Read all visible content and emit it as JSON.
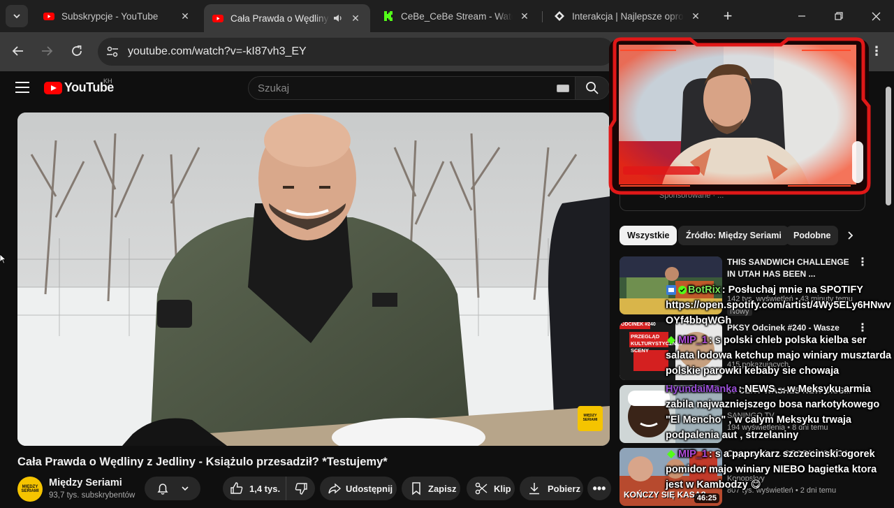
{
  "browser": {
    "tabs": [
      {
        "title": "Subskrypcje - YouTube",
        "favicon": "youtube-icon",
        "active": false
      },
      {
        "title": "Cała Prawda o Wędliny z",
        "favicon": "youtube-icon",
        "active": true,
        "audio": true
      },
      {
        "title": "CeBe_CeBe Stream - Watch L",
        "favicon": "kick-icon",
        "active": false
      },
      {
        "title": "Interakcja | Najlepsze oprog",
        "favicon": "interakcja-icon",
        "active": false
      }
    ],
    "new_tab_symbol": "+",
    "url": "youtube.com/watch?v=-kI87vh3_EY"
  },
  "youtube": {
    "logo_text": "YouTube",
    "country_code": "KH",
    "search_placeholder": "Szukaj"
  },
  "video": {
    "title": "Cała Prawda o Wędliny z Jedliny - Książulo przesadził? *Testujemy*",
    "channel": {
      "name": "Między Seriami",
      "subscribers": "93,7 tys. subskrybentów",
      "avatar_text": "MIĘDZY SERIAMI"
    },
    "actions": {
      "likes": "1,4 tys.",
      "share": "Udostępnij",
      "save": "Zapisz",
      "clip": "Klip",
      "download": "Pobierz"
    },
    "watermark_text": "MIĘDZY SERIAMI"
  },
  "sidebar": {
    "partial_text": "Sponsorowane · ...",
    "chips": [
      "Wszystkie",
      "Źródło: Między Seriami",
      "Podobne"
    ],
    "recommendations": [
      {
        "title": "THIS SANDWICH CHALLENGE IN UTAH HAS BEEN ...",
        "meta1": "142 tys. wyświetleń • 43 minuty temu",
        "badge": "Nowy"
      },
      {
        "title": "PKSY Odcinek #240 - Wasze",
        "meta1": "415 pokazujących",
        "thumb_text": "PRZEGLĄD KULTURYSTYCZNEJ SCENY",
        "thumb_badge": "ODCINEK #240"
      },
      {
        "title": "50 CENT WASHES NEW DISS...",
        "meta1": "SANINGO TV",
        "meta2": "194 wyświetlenia • 8 dni temu"
      },
      {
        "title": "Czy rozmiar... GROBU KSIĘGA",
        "meta1": "Konopskyy",
        "meta2": "807 tys. wyświetleń • 2 dni temu",
        "duration": "46:25",
        "thumb_text": "KOŃCZY SIĘ KASA?"
      }
    ]
  },
  "chat": [
    {
      "user": "BotRix",
      "user_color": "#7ce65a",
      "text": ": Posłuchaj mnie na SPOTIFY https://open.spotify.com/artist/4Wy5ELy6HNwvOYf4bbqWGh"
    },
    {
      "user": "MIP_1",
      "user_color": "#b04bd8",
      "text": ": s polski chleb polska kielba ser salata lodowa ketchup majo winiary musztarda polskie parowki kebaby sie chowaja"
    },
    {
      "user": "HyundaiManka",
      "user_color": "#9b4fd9",
      "text": ": NEWS -- w Meksyku armia zabila najwazniejszego bosa narkotykowego \"El Mencho\" , w calym Meksyku trwaja podpalenia aut , strzelaniny"
    },
    {
      "user": "MIP_1",
      "user_color": "#b04bd8",
      "text": ": s a paprykarz szczecinski ogorek pomidor majo winiary NIEBO bagietka ktora jest w Kambodzy 😋"
    }
  ],
  "colors": {
    "yt_red": "#ff0000",
    "bg": "#0f0f0f",
    "chrome_bg": "#1f1f1f",
    "toolbar_bg": "#3a3a3a",
    "webcam_frame": "#e01818"
  }
}
